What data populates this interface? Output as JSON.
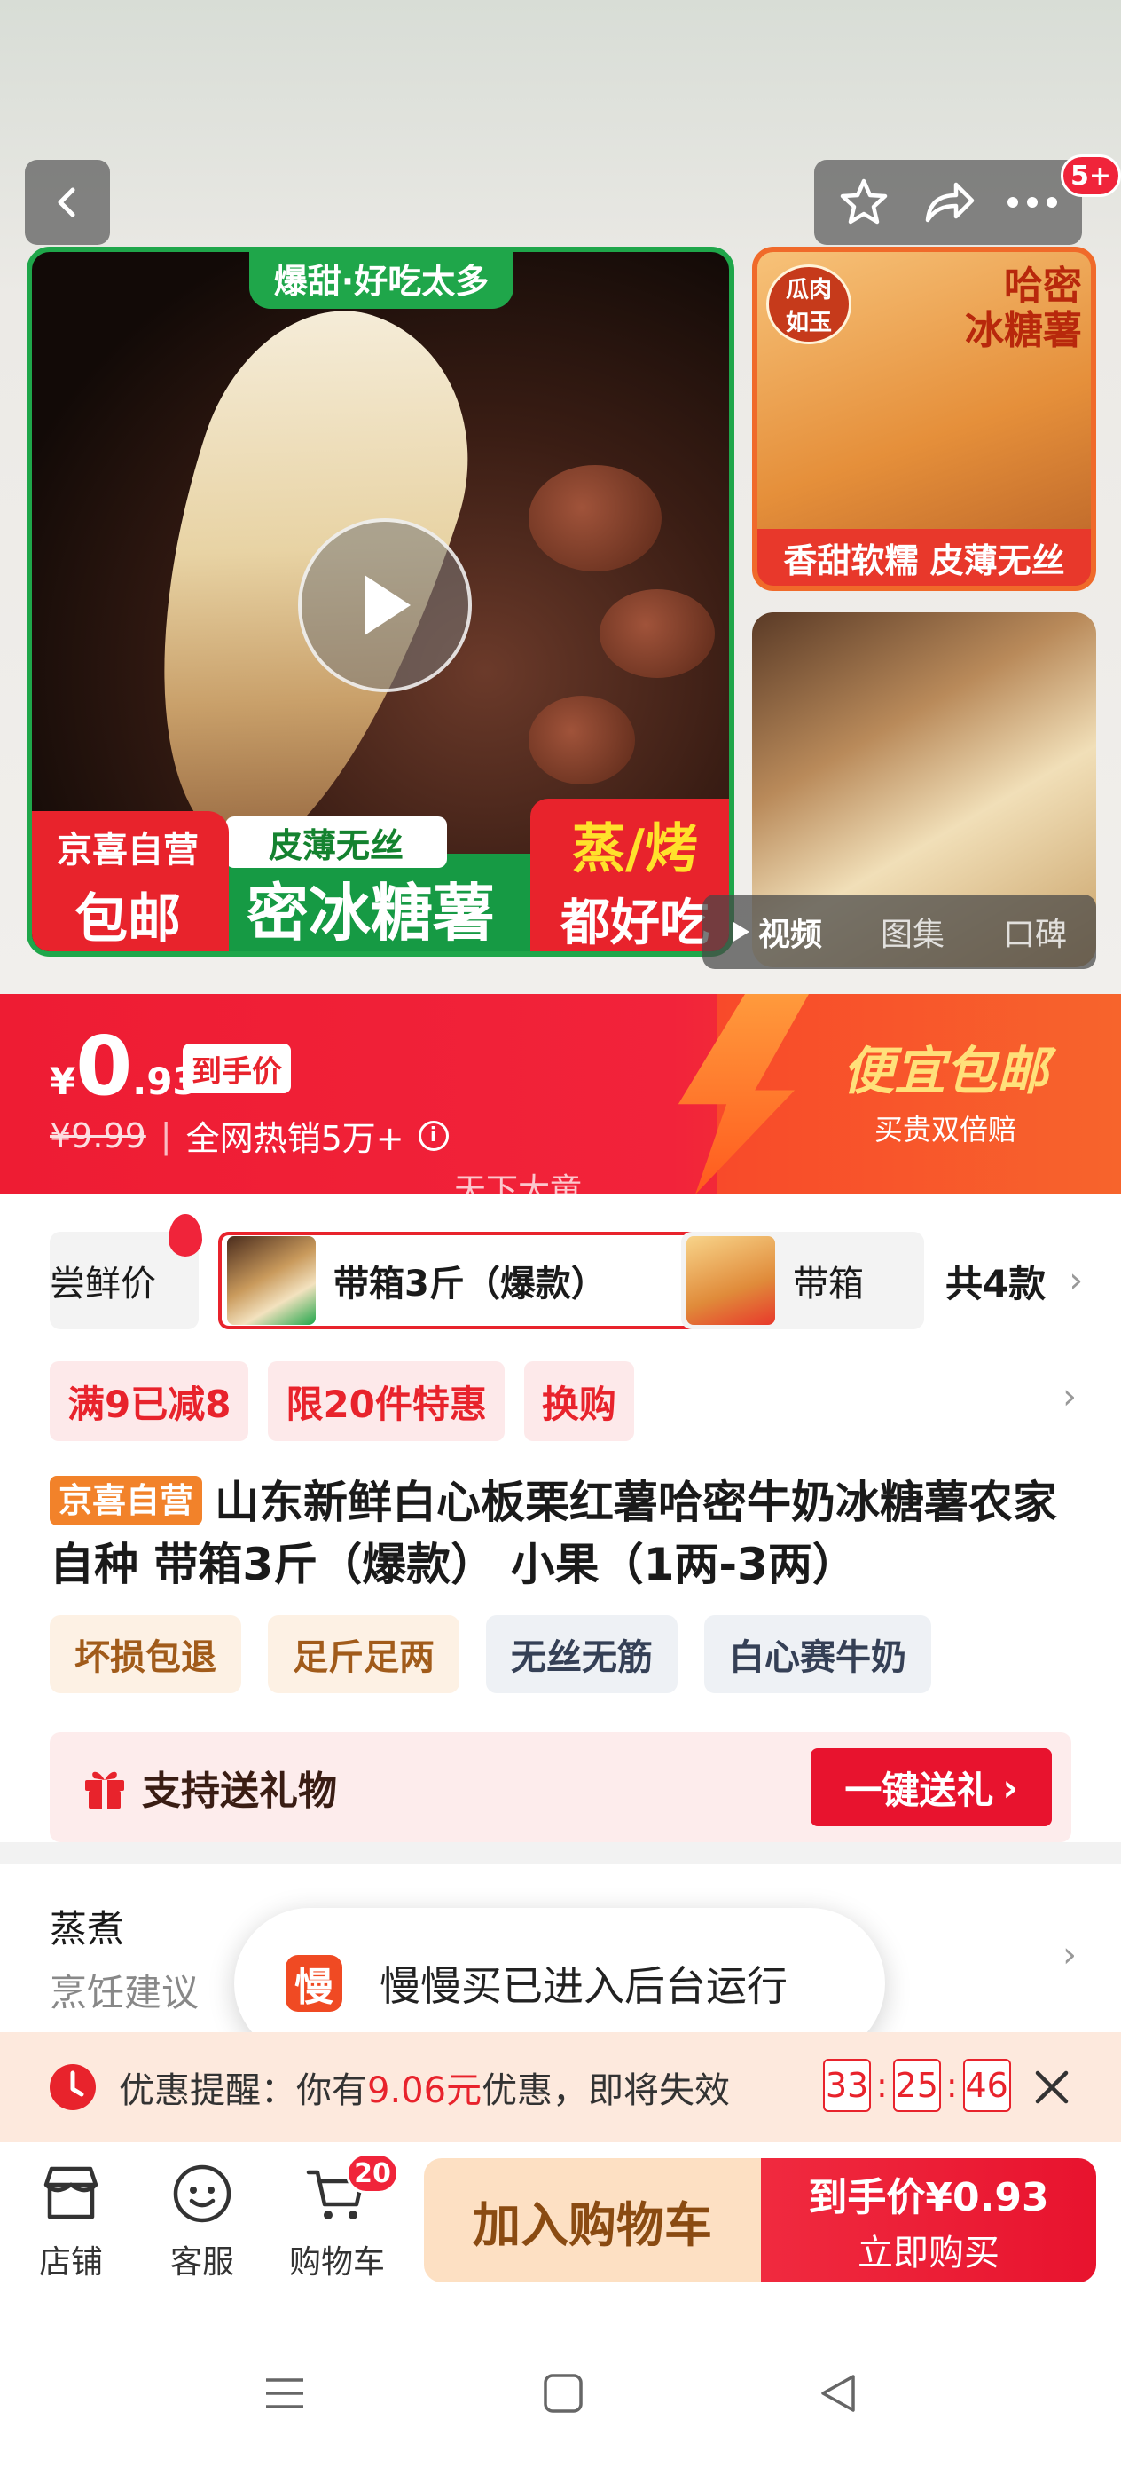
{
  "header": {
    "notification_count": "5+",
    "icons": [
      "back-icon",
      "star-icon",
      "share-icon",
      "more-icon"
    ]
  },
  "hero": {
    "main_image": {
      "top_tag": "爆甜·好吃太多",
      "badge_line1": "京喜自营",
      "badge_line2": "包邮",
      "white_tag": "皮薄无丝",
      "green_banner": "密冰糖薯",
      "red_line1": "蒸/烤",
      "red_line2": "都好吃"
    },
    "thumb1": {
      "round_badge_line1": "瓜肉",
      "round_badge_line2": "如玉",
      "title_line1": "哈密",
      "title_line2": "冰糖薯",
      "bottom_bar": "香甜软糯 皮薄无丝"
    },
    "media_tabs": {
      "video": "视频",
      "gallery": "图集",
      "reviews": "口碑"
    }
  },
  "price": {
    "currency": "¥",
    "integer": "0",
    "decimal": ".93",
    "final_tag": "到手价",
    "original": "¥9.99",
    "sales": "全网热销5万+",
    "promo_title": "便宜包邮",
    "promo_sub": "买贵双倍赔",
    "watermark": "天下大童"
  },
  "sku": {
    "option1": "尝鲜价",
    "option2": "带箱3斤（爆款）",
    "option3": "带箱",
    "total": "共4款"
  },
  "coupons": [
    "满9已减8",
    "限20件特惠",
    "换购"
  ],
  "product": {
    "self_tag": "京喜自营",
    "title": "山东新鲜白心板栗红薯哈密牛奶冰糖薯农家自种 带箱3斤（爆款） 小果（1两-3两）"
  },
  "features": [
    "坏损包退",
    "足斤足两",
    "无丝无筋",
    "白心赛牛奶"
  ],
  "gift": {
    "label": "支持送礼物",
    "button": "一键送礼"
  },
  "cooking": {
    "method": "蒸煮",
    "label": "烹饪建议"
  },
  "toast": {
    "icon_char": "慢",
    "message": "慢慢买已进入后台运行"
  },
  "reminder": {
    "prefix": "优惠提醒：你有",
    "amount": "9.06元",
    "suffix": "优惠，即将失效",
    "hours": "33",
    "minutes": "25",
    "seconds": "46"
  },
  "bottom_bar": {
    "store": "店铺",
    "service": "客服",
    "cart": "购物车",
    "cart_count": "20",
    "add_to_cart": "加入购物车",
    "buy_line1": "到手价¥0.93",
    "buy_line2": "立即购买"
  },
  "colors": {
    "brand_red": "#e8232c",
    "green": "#1fa64a",
    "orange": "#f2822a"
  }
}
